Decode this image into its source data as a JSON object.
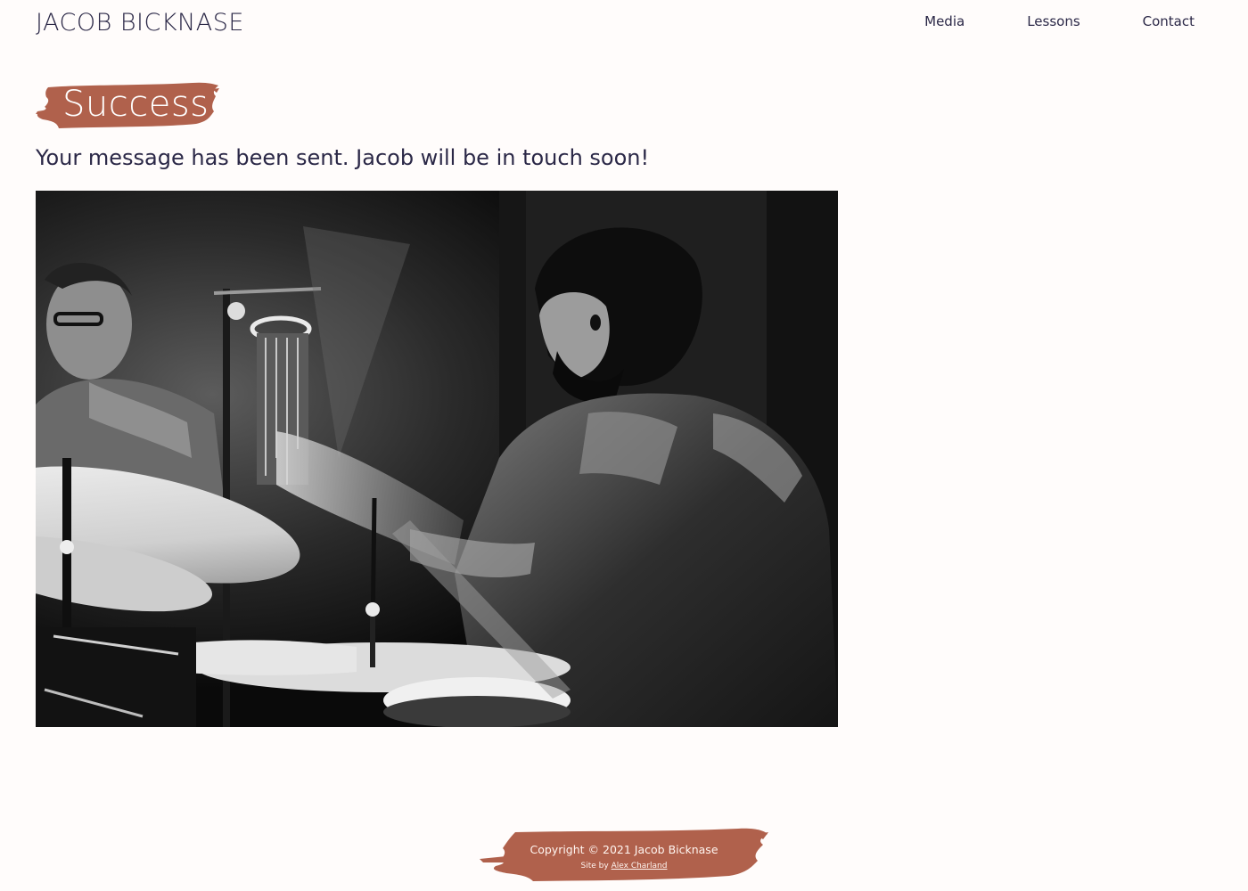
{
  "header": {
    "site_title": "JACOB BICKNASE",
    "nav": [
      {
        "label": "Media"
      },
      {
        "label": "Lessons"
      },
      {
        "label": "Contact"
      }
    ]
  },
  "main": {
    "title": "Success",
    "message": "Your message has been sent. Jacob will be in touch soon!"
  },
  "footer": {
    "copyright": "Copyright © 2021 Jacob Bicknase",
    "site_by_prefix": "Site by",
    "site_by_link": "Alex Charland"
  },
  "colors": {
    "background": "#fffcfb",
    "text": "#2b2847",
    "accent_brush": "#b0614c"
  }
}
